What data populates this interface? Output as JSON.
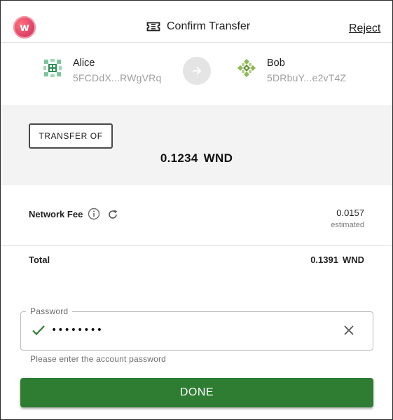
{
  "header": {
    "logo_letter": "w",
    "title": "Confirm Transfer",
    "reject_label": "Reject",
    "ticket_icon": "ticket-icon"
  },
  "from": {
    "name": "Alice",
    "address": "5FCDdX...RWgVRq"
  },
  "to": {
    "name": "Bob",
    "address": "5DRbuY...e2vT4Z"
  },
  "transfer": {
    "chip_label": "TRANSFER OF",
    "amount": "0.1234",
    "unit": "WND"
  },
  "fee": {
    "label": "Network Fee",
    "value": "0.0157",
    "note": "estimated"
  },
  "total": {
    "label": "Total",
    "value": "0.1391",
    "unit": "WND"
  },
  "password": {
    "legend": "Password",
    "value": "••••••••",
    "helper": "Please enter the account password"
  },
  "done_label": "DONE",
  "colors": {
    "primary_green": "#2e7d32",
    "band_grey": "#f3f3f3",
    "logo_pink": "#e2466a"
  }
}
